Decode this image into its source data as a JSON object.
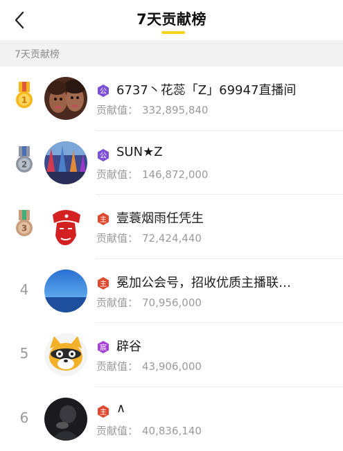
{
  "header": {
    "title": "7天贡献榜",
    "accent_color": "#f7d21a"
  },
  "section": {
    "label": "7天贡献榜"
  },
  "contrib_label": "贡献值：",
  "rows": [
    {
      "rank": "1",
      "medal": "gold",
      "badge": "purple",
      "badge_char": "公",
      "name": "6737丶花蕊「Z」69947直播间",
      "value": "332,895,840"
    },
    {
      "rank": "2",
      "medal": "silver",
      "badge": "purple",
      "badge_char": "公",
      "name": "SUN★Z",
      "value": "146,872,000"
    },
    {
      "rank": "3",
      "medal": "bronze",
      "badge": "red",
      "badge_char": "主",
      "name": "壹蓑烟雨任凭生",
      "value": "72,424,440"
    },
    {
      "rank": "4",
      "medal": "",
      "badge": "red",
      "badge_char": "主",
      "name": "冕加公会号，招收优质主播联…",
      "value": "70,956,000"
    },
    {
      "rank": "5",
      "medal": "",
      "badge": "violet",
      "badge_char": "宸",
      "name": "辟谷",
      "value": "43,906,000"
    },
    {
      "rank": "6",
      "medal": "",
      "badge": "red",
      "badge_char": "主",
      "name": "∧",
      "value": "40,836,140"
    }
  ],
  "colors": {
    "gold": "#f5b71d",
    "silver": "#8e96a3",
    "bronze": "#c99c7c",
    "badge_purple": "#7b4fd6",
    "badge_red": "#e0492f",
    "badge_violet": "#a442d8"
  }
}
